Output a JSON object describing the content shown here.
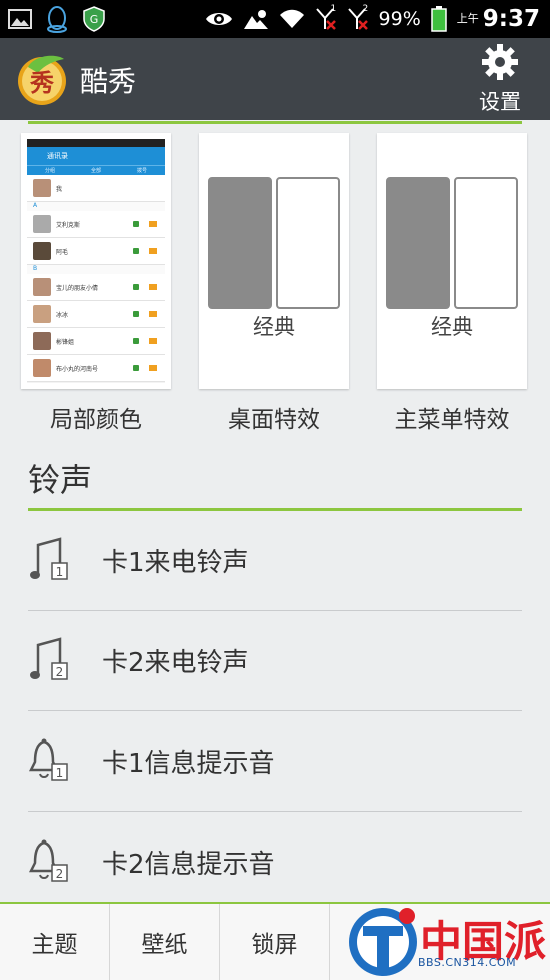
{
  "status_bar": {
    "battery": "99%",
    "ampm": "上午",
    "time": "9:37",
    "sim1": "1",
    "sim2": "2"
  },
  "app_bar": {
    "title": "酷秀",
    "settings_label": "设置"
  },
  "theme_cards": [
    {
      "label": "局部颜色"
    },
    {
      "label": "桌面特效",
      "mode": "经典"
    },
    {
      "label": "主菜单特效",
      "mode": "经典"
    }
  ],
  "preview": {
    "header": "通讯录",
    "tabs": [
      "分组",
      "全部",
      "拨号"
    ],
    "sections": [
      "A",
      "B"
    ],
    "contacts": [
      "我",
      "艾利克斯",
      "阿毛",
      "宝儿的朋友小倩",
      "冰冰",
      "彬锋姐",
      "布小丸的河南号"
    ]
  },
  "ringtones": {
    "title": "铃声",
    "items": [
      {
        "label": "卡1来电铃声",
        "icon": "music-note-icon",
        "card": "1"
      },
      {
        "label": "卡2来电铃声",
        "icon": "music-note-icon",
        "card": "2"
      },
      {
        "label": "卡1信息提示音",
        "icon": "bell-icon",
        "card": "1"
      },
      {
        "label": "卡2信息提示音",
        "icon": "bell-icon",
        "card": "2"
      }
    ]
  },
  "bottom_tabs": [
    "主题",
    "壁纸",
    "锁屏"
  ],
  "watermark": {
    "text": "中国派",
    "url": "BBS.CN314.COM"
  },
  "colors": {
    "accent_green": "#8cc63f",
    "appbar": "#3f4449",
    "background": "#eceeef"
  }
}
